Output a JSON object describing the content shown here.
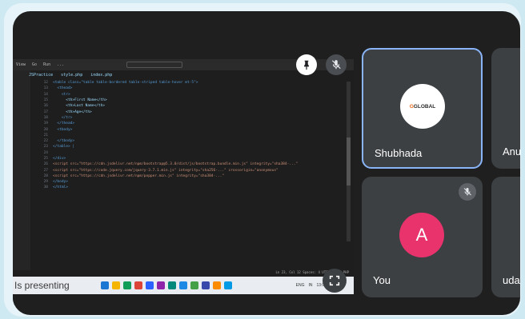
{
  "presentation": {
    "presenter_label": "Is presenting",
    "editor": {
      "menu": [
        "View",
        "Go",
        "Run",
        "..."
      ],
      "search_placeholder": "",
      "tabs": [
        "JSPractice",
        "style.php",
        "index.php"
      ],
      "lines": [
        {
          "n": "12",
          "t": "<table class=\"table table-bordered table-striped table-hover mt-5\">",
          "c": "tag"
        },
        {
          "n": "13",
          "t": "  <thead>",
          "c": "tag"
        },
        {
          "n": "14",
          "t": "    <tr>",
          "c": "tag"
        },
        {
          "n": "15",
          "t": "      <th>First Name</th>",
          "c": ""
        },
        {
          "n": "16",
          "t": "      <th>Last Name</th>",
          "c": ""
        },
        {
          "n": "17",
          "t": "      <th>Age</th>",
          "c": ""
        },
        {
          "n": "18",
          "t": "    </tr>",
          "c": "tag"
        },
        {
          "n": "19",
          "t": "  </thead>",
          "c": "tag"
        },
        {
          "n": "20",
          "t": "  <tbody>",
          "c": "tag"
        },
        {
          "n": "21",
          "t": "",
          "c": ""
        },
        {
          "n": "22",
          "t": "  </tbody>",
          "c": "tag"
        },
        {
          "n": "23",
          "t": "</table> |",
          "c": "tag"
        },
        {
          "n": "24",
          "t": "",
          "c": ""
        },
        {
          "n": "25",
          "t": "</div>",
          "c": "tag"
        },
        {
          "n": "26",
          "t": "<script src=\"https://cdn.jsdelivr.net/npm/bootstrap@5.3.0/dist/js/bootstrap.bundle.min.js\" integrity=\"sha384-...\"",
          "c": "str"
        },
        {
          "n": "27",
          "t": "<script src=\"https://code.jquery.com/jquery-3.7.1.min.js\" integrity=\"sha256-...\" crossorigin=\"anonymous\"",
          "c": "str"
        },
        {
          "n": "28",
          "t": "<script src=\"https://cdn.jsdelivr.net/npm/popper.min.js\" integrity=\"sha384-...\"",
          "c": "str"
        },
        {
          "n": "29",
          "t": "</body>",
          "c": "tag"
        },
        {
          "n": "30",
          "t": "</html>",
          "c": "tag"
        }
      ],
      "status": "Ln 23, Col 12  Spaces: 4  UTF-8  CRLF  PHP"
    },
    "tray": [
      "ENG",
      "IN",
      "13:04"
    ]
  },
  "participants": [
    {
      "name": "Shubhada",
      "avatar_text": "GLOBAL",
      "avatar_prefix": "G",
      "active": true
    },
    {
      "name": "Anu",
      "active": false
    },
    {
      "name": "You",
      "avatar_letter": "A",
      "muted": true
    },
    {
      "name": "uday",
      "active": false
    }
  ],
  "colors": {
    "background": "#1f1f1f",
    "tile": "#3c4043",
    "active_border": "#8ab4f8",
    "avatar_you": "#e8336d"
  },
  "icons": {
    "pin": "pin-icon",
    "mic_off": "mic-off-icon",
    "fullscreen": "fullscreen-icon"
  }
}
